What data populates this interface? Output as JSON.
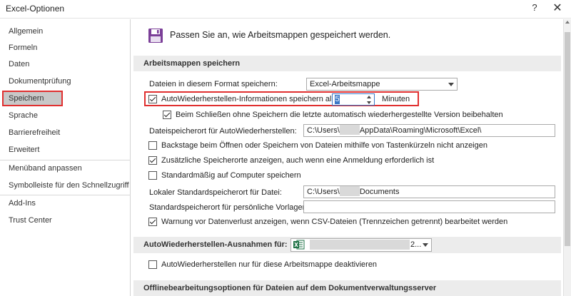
{
  "window": {
    "title": "Excel-Optionen",
    "help": "?",
    "close": "✕"
  },
  "sidebar": {
    "items": [
      {
        "label": "Allgemein"
      },
      {
        "label": "Formeln"
      },
      {
        "label": "Daten"
      },
      {
        "label": "Dokumentprüfung"
      },
      {
        "label": "Speichern"
      },
      {
        "label": "Sprache"
      },
      {
        "label": "Barrierefreiheit"
      },
      {
        "label": "Erweitert"
      },
      {
        "label": "Menüband anpassen"
      },
      {
        "label": "Symbolleiste für den Schnellzugriff"
      },
      {
        "label": "Add-Ins"
      },
      {
        "label": "Trust Center"
      }
    ],
    "selected": "Speichern"
  },
  "main": {
    "header": "Passen Sie an, wie Arbeitsmappen gespeichert werden.",
    "section_save": {
      "title": "Arbeitsmappen speichern",
      "format_label": "Dateien in diesem Format speichern:",
      "format_value": "Excel-Arbeitsmappe",
      "autorecover_label": "AutoWiederherstellen-Informationen speichern alle",
      "autorecover_checked": true,
      "autorecover_minutes": "5",
      "minutes_unit": "Minuten",
      "keep_last_label": "Beim Schließen ohne Speichern die letzte automatisch wiederhergestellte Version beibehalten",
      "keep_last_checked": true,
      "autorecover_location_label": "Dateispeicherort für AutoWiederherstellen:",
      "autorecover_location_prefix": "C:\\Users\\",
      "autorecover_location_suffix": "AppData\\Roaming\\Microsoft\\Excel\\",
      "backstage_label": "Backstage beim Öffnen oder Speichern von Dateien mithilfe von Tastenkürzeln nicht anzeigen",
      "backstage_checked": false,
      "additional_locations_label": "Zusätzliche Speicherorte anzeigen, auch wenn eine Anmeldung erforderlich ist",
      "additional_locations_checked": true,
      "default_computer_label": "Standardmäßig auf Computer speichern",
      "default_computer_checked": false,
      "local_default_label": "Lokaler Standardspeicherort für Datei:",
      "local_default_prefix": "C:\\Users\\",
      "local_default_suffix": "Documents",
      "personal_templates_label": "Standardspeicherort für persönliche Vorlagen:",
      "personal_templates_value": "",
      "csv_warning_label": "Warnung vor Datenverlust anzeigen, wenn CSV-Dateien (Trennzeichen getrennt) bearbeitet werden",
      "csv_warning_checked": true
    },
    "section_exceptions": {
      "title": "AutoWiederherstellen-Ausnahmen für:",
      "workbook_value": "2...",
      "disable_label": "AutoWiederherstellen nur für diese Arbeitsmappe deaktivieren",
      "disable_checked": false
    },
    "section_offline": {
      "title": "Offlinebearbeitungsoptionen für Dateien auf dem Dokumentverwaltungsserver"
    }
  },
  "icons": {
    "save": "save-disk-icon",
    "excel": "excel-workbook-icon",
    "dropdown": "chevron-down-icon",
    "spin_up": "spin-up-icon",
    "spin_down": "spin-down-icon"
  },
  "colors": {
    "highlight": "#e03030",
    "selected_bg": "#c8c8c8",
    "section_bg": "#ececec",
    "save_icon": "#7b3f98",
    "excel_green": "#1e7145",
    "focus_blue": "#3a78c8"
  }
}
